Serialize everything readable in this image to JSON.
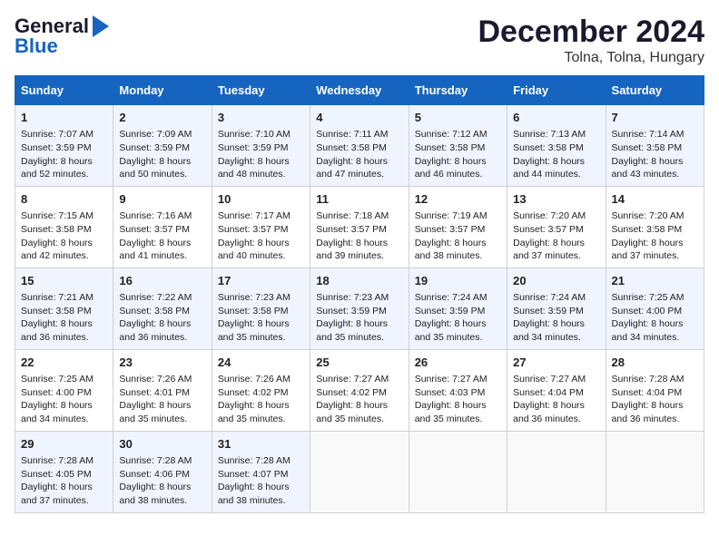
{
  "header": {
    "logo_line1": "General",
    "logo_line2": "Blue",
    "title": "December 2024",
    "subtitle": "Tolna, Tolna, Hungary"
  },
  "days_of_week": [
    "Sunday",
    "Monday",
    "Tuesday",
    "Wednesday",
    "Thursday",
    "Friday",
    "Saturday"
  ],
  "weeks": [
    [
      {
        "day": 1,
        "lines": [
          "Sunrise: 7:07 AM",
          "Sunset: 3:59 PM",
          "Daylight: 8 hours",
          "and 52 minutes."
        ]
      },
      {
        "day": 2,
        "lines": [
          "Sunrise: 7:09 AM",
          "Sunset: 3:59 PM",
          "Daylight: 8 hours",
          "and 50 minutes."
        ]
      },
      {
        "day": 3,
        "lines": [
          "Sunrise: 7:10 AM",
          "Sunset: 3:59 PM",
          "Daylight: 8 hours",
          "and 48 minutes."
        ]
      },
      {
        "day": 4,
        "lines": [
          "Sunrise: 7:11 AM",
          "Sunset: 3:58 PM",
          "Daylight: 8 hours",
          "and 47 minutes."
        ]
      },
      {
        "day": 5,
        "lines": [
          "Sunrise: 7:12 AM",
          "Sunset: 3:58 PM",
          "Daylight: 8 hours",
          "and 46 minutes."
        ]
      },
      {
        "day": 6,
        "lines": [
          "Sunrise: 7:13 AM",
          "Sunset: 3:58 PM",
          "Daylight: 8 hours",
          "and 44 minutes."
        ]
      },
      {
        "day": 7,
        "lines": [
          "Sunrise: 7:14 AM",
          "Sunset: 3:58 PM",
          "Daylight: 8 hours",
          "and 43 minutes."
        ]
      }
    ],
    [
      {
        "day": 8,
        "lines": [
          "Sunrise: 7:15 AM",
          "Sunset: 3:58 PM",
          "Daylight: 8 hours",
          "and 42 minutes."
        ]
      },
      {
        "day": 9,
        "lines": [
          "Sunrise: 7:16 AM",
          "Sunset: 3:57 PM",
          "Daylight: 8 hours",
          "and 41 minutes."
        ]
      },
      {
        "day": 10,
        "lines": [
          "Sunrise: 7:17 AM",
          "Sunset: 3:57 PM",
          "Daylight: 8 hours",
          "and 40 minutes."
        ]
      },
      {
        "day": 11,
        "lines": [
          "Sunrise: 7:18 AM",
          "Sunset: 3:57 PM",
          "Daylight: 8 hours",
          "and 39 minutes."
        ]
      },
      {
        "day": 12,
        "lines": [
          "Sunrise: 7:19 AM",
          "Sunset: 3:57 PM",
          "Daylight: 8 hours",
          "and 38 minutes."
        ]
      },
      {
        "day": 13,
        "lines": [
          "Sunrise: 7:20 AM",
          "Sunset: 3:57 PM",
          "Daylight: 8 hours",
          "and 37 minutes."
        ]
      },
      {
        "day": 14,
        "lines": [
          "Sunrise: 7:20 AM",
          "Sunset: 3:58 PM",
          "Daylight: 8 hours",
          "and 37 minutes."
        ]
      }
    ],
    [
      {
        "day": 15,
        "lines": [
          "Sunrise: 7:21 AM",
          "Sunset: 3:58 PM",
          "Daylight: 8 hours",
          "and 36 minutes."
        ]
      },
      {
        "day": 16,
        "lines": [
          "Sunrise: 7:22 AM",
          "Sunset: 3:58 PM",
          "Daylight: 8 hours",
          "and 36 minutes."
        ]
      },
      {
        "day": 17,
        "lines": [
          "Sunrise: 7:23 AM",
          "Sunset: 3:58 PM",
          "Daylight: 8 hours",
          "and 35 minutes."
        ]
      },
      {
        "day": 18,
        "lines": [
          "Sunrise: 7:23 AM",
          "Sunset: 3:59 PM",
          "Daylight: 8 hours",
          "and 35 minutes."
        ]
      },
      {
        "day": 19,
        "lines": [
          "Sunrise: 7:24 AM",
          "Sunset: 3:59 PM",
          "Daylight: 8 hours",
          "and 35 minutes."
        ]
      },
      {
        "day": 20,
        "lines": [
          "Sunrise: 7:24 AM",
          "Sunset: 3:59 PM",
          "Daylight: 8 hours",
          "and 34 minutes."
        ]
      },
      {
        "day": 21,
        "lines": [
          "Sunrise: 7:25 AM",
          "Sunset: 4:00 PM",
          "Daylight: 8 hours",
          "and 34 minutes."
        ]
      }
    ],
    [
      {
        "day": 22,
        "lines": [
          "Sunrise: 7:25 AM",
          "Sunset: 4:00 PM",
          "Daylight: 8 hours",
          "and 34 minutes."
        ]
      },
      {
        "day": 23,
        "lines": [
          "Sunrise: 7:26 AM",
          "Sunset: 4:01 PM",
          "Daylight: 8 hours",
          "and 35 minutes."
        ]
      },
      {
        "day": 24,
        "lines": [
          "Sunrise: 7:26 AM",
          "Sunset: 4:02 PM",
          "Daylight: 8 hours",
          "and 35 minutes."
        ]
      },
      {
        "day": 25,
        "lines": [
          "Sunrise: 7:27 AM",
          "Sunset: 4:02 PM",
          "Daylight: 8 hours",
          "and 35 minutes."
        ]
      },
      {
        "day": 26,
        "lines": [
          "Sunrise: 7:27 AM",
          "Sunset: 4:03 PM",
          "Daylight: 8 hours",
          "and 35 minutes."
        ]
      },
      {
        "day": 27,
        "lines": [
          "Sunrise: 7:27 AM",
          "Sunset: 4:04 PM",
          "Daylight: 8 hours",
          "and 36 minutes."
        ]
      },
      {
        "day": 28,
        "lines": [
          "Sunrise: 7:28 AM",
          "Sunset: 4:04 PM",
          "Daylight: 8 hours",
          "and 36 minutes."
        ]
      }
    ],
    [
      {
        "day": 29,
        "lines": [
          "Sunrise: 7:28 AM",
          "Sunset: 4:05 PM",
          "Daylight: 8 hours",
          "and 37 minutes."
        ]
      },
      {
        "day": 30,
        "lines": [
          "Sunrise: 7:28 AM",
          "Sunset: 4:06 PM",
          "Daylight: 8 hours",
          "and 38 minutes."
        ]
      },
      {
        "day": 31,
        "lines": [
          "Sunrise: 7:28 AM",
          "Sunset: 4:07 PM",
          "Daylight: 8 hours",
          "and 38 minutes."
        ]
      },
      null,
      null,
      null,
      null
    ]
  ]
}
